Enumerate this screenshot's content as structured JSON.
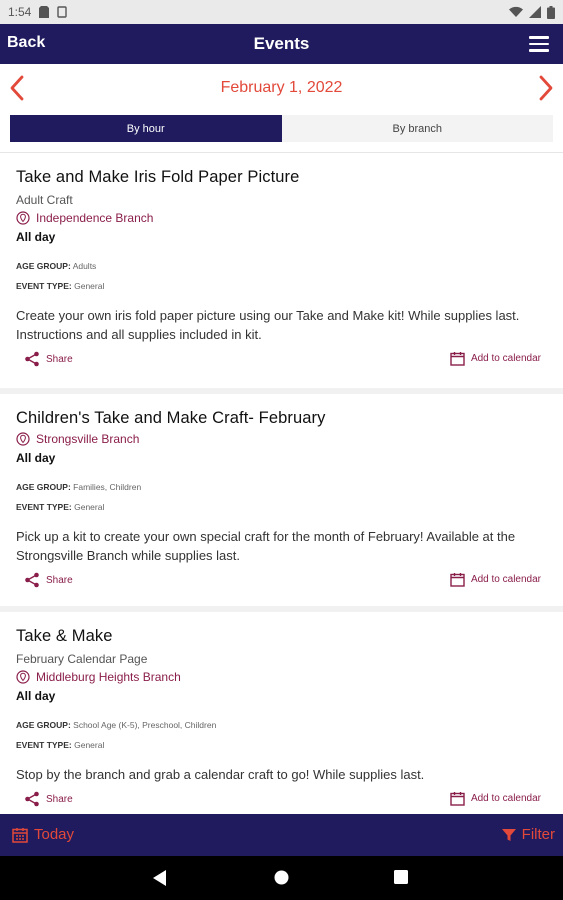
{
  "status_bar": {
    "time": "1:54"
  },
  "header": {
    "back_label": "Back",
    "title": "Events"
  },
  "date_nav": {
    "date": "February 1, 2022"
  },
  "segment": {
    "by_hour": "By hour",
    "by_branch": "By branch",
    "active": "by_hour"
  },
  "events": [
    {
      "title": "Take and Make Iris Fold Paper Picture",
      "subtitle": "Adult Craft",
      "branch": "Independence Branch",
      "time": "All day",
      "age_group_label": "AGE GROUP:",
      "age_group": "Adults",
      "event_type_label": "EVENT TYPE:",
      "event_type": "General",
      "description": "Create your own iris fold paper picture using our Take and Make kit! While supplies last. Instructions and all supplies included in kit.",
      "share_label": "Share",
      "calendar_label": "Add to calendar"
    },
    {
      "title": "Children's Take and Make Craft- February",
      "subtitle": "",
      "branch": "Strongsville Branch",
      "time": "All day",
      "age_group_label": "AGE GROUP:",
      "age_group": "Families, Children",
      "event_type_label": "EVENT TYPE:",
      "event_type": "General",
      "description": "Pick up a kit to create your own special craft for the month of February! Available at the Strongsville Branch while supplies last.",
      "share_label": "Share",
      "calendar_label": "Add to calendar"
    },
    {
      "title": "Take & Make",
      "subtitle": "February Calendar Page",
      "branch": "Middleburg Heights Branch",
      "time": "All day",
      "age_group_label": "AGE GROUP:",
      "age_group": "School Age (K-5), Preschool, Children",
      "event_type_label": "EVENT TYPE:",
      "event_type": "General",
      "description": "Stop by the branch and grab a calendar craft to go! While supplies last.",
      "share_label": "Share",
      "calendar_label": "Add to calendar"
    }
  ],
  "tab_bar": {
    "today_label": "Today",
    "filter_label": "Filter"
  },
  "colors": {
    "primary": "#1f1b5e",
    "accent": "#e2493a",
    "link": "#8a1e4a"
  },
  "icons": [
    "back-arrow",
    "menu-icon",
    "chevron-left-icon",
    "chevron-right-icon",
    "location-pin-icon",
    "share-icon",
    "calendar-icon",
    "filter-icon",
    "nav-back-icon",
    "nav-home-icon",
    "nav-recents-icon"
  ]
}
